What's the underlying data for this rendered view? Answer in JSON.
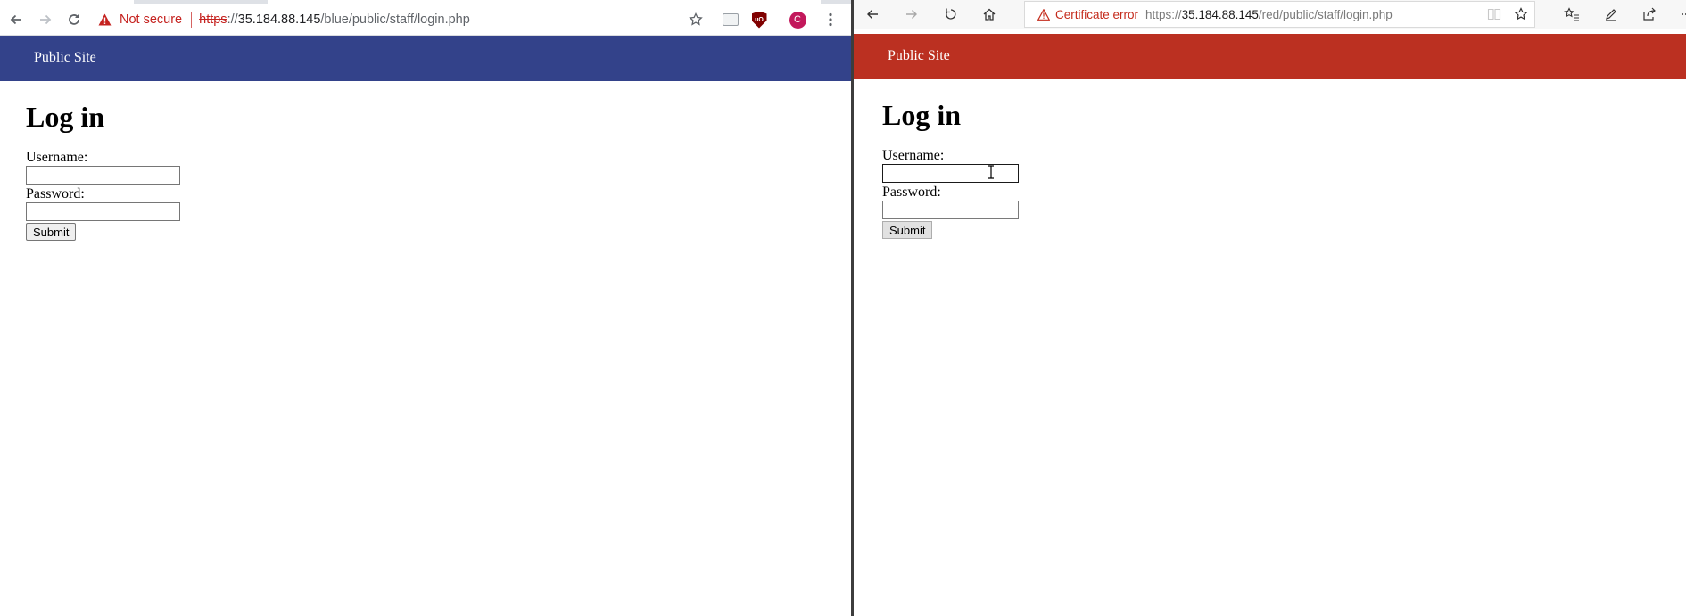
{
  "left_window": {
    "browser": {
      "security_label": "Not secure",
      "url_scheme": "https",
      "url_separator": "://",
      "url_host": "35.184.88.145",
      "url_path": "/blue/public/staff/login.php",
      "profile_initial": "C",
      "ublock_label": "uO"
    },
    "page": {
      "nav_brand": "Public Site",
      "title": "Log in",
      "username_label": "Username:",
      "password_label": "Password:",
      "submit_label": "Submit",
      "username_value": "",
      "password_value": ""
    },
    "theme_color": "#33428a"
  },
  "right_window": {
    "browser": {
      "security_label": "Certificate error",
      "url_scheme": "https://",
      "url_host": "35.184.88.145",
      "url_path": "/red/public/staff/login.php"
    },
    "page": {
      "nav_brand": "Public Site",
      "title": "Log in",
      "username_label": "Username:",
      "password_label": "Password:",
      "submit_label": "Submit",
      "username_value": "",
      "password_value": ""
    },
    "theme_color": "#bb3021"
  },
  "icons": [
    "back-icon",
    "forward-icon",
    "reload-icon",
    "home-icon",
    "warning-icon",
    "star-icon",
    "menu-icon",
    "reading-view-icon",
    "favorites-icon",
    "pen-icon",
    "share-icon",
    "more-icon",
    "text-cursor-icon"
  ]
}
